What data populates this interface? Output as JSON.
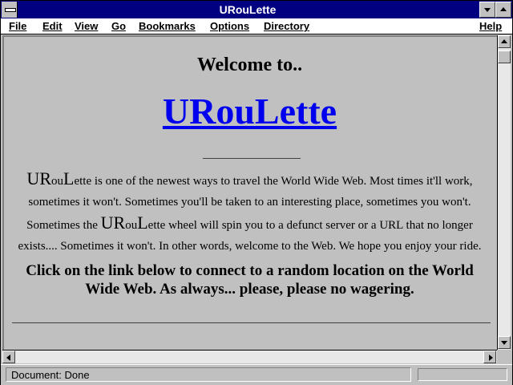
{
  "window": {
    "title": "URouLette"
  },
  "menu": {
    "items": [
      "File",
      "Edit",
      "View",
      "Go",
      "Bookmarks",
      "Options",
      "Directory"
    ],
    "help": "Help"
  },
  "page": {
    "welcome": "Welcome to..",
    "link_text": "URouLette",
    "intro": {
      "brand_U": "U",
      "brand_R": "R",
      "brand_ou": "ou",
      "brand_L": "L",
      "part1": "ette is one of the newest ways to travel the World Wide Web. Most times it'll work, sometimes it won't. Sometimes you'll be taken to an interesting place, sometimes you won't. Sometimes the ",
      "part2": "ette wheel will spin you to a defunct server or a URL that no longer exists.... Sometimes it won't. In other words, welcome to the Web. We hope you enjoy your ride."
    },
    "cta": "Click on the link below to connect to a random location on the World Wide Web. As always... please, please no wagering."
  },
  "status": {
    "text": "Document: Done"
  },
  "icons": {
    "system_menu": "system-menu-icon",
    "minimize": "triangle-down-icon",
    "maximize": "triangle-up-icon",
    "scroll_up": "triangle-up-icon",
    "scroll_down": "triangle-down-icon",
    "scroll_left": "triangle-left-icon",
    "scroll_right": "triangle-right-icon"
  },
  "colors": {
    "title_bar": "#000080",
    "link": "#0000ee",
    "background": "#c0c0c0"
  }
}
